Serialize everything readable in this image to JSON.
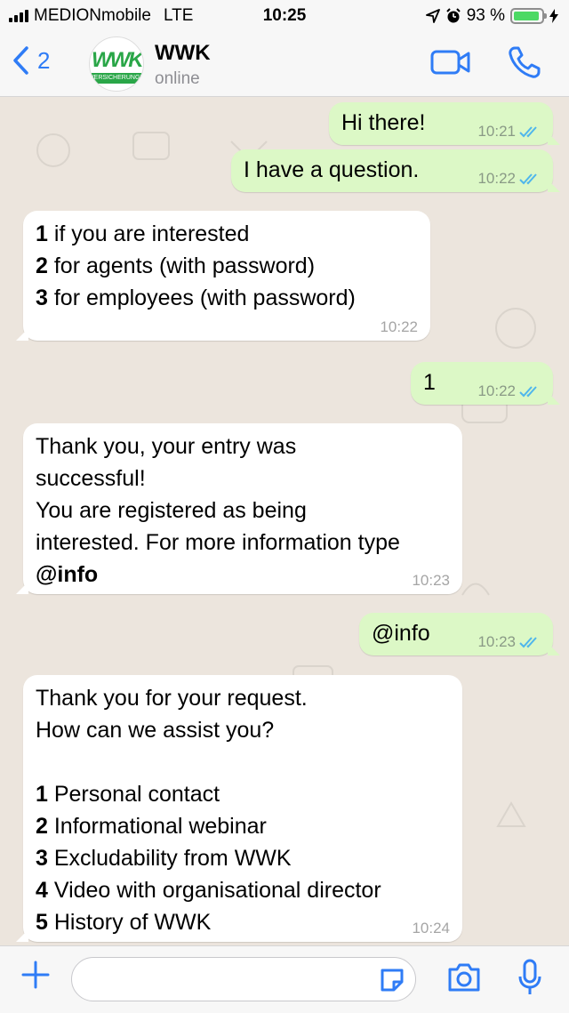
{
  "status_bar": {
    "carrier": "MEDIONmobile",
    "network": "LTE",
    "time": "10:25",
    "battery": "93 %",
    "battery_level": 0.93
  },
  "header": {
    "back_count": "2",
    "contact_name": "WWK",
    "status": "online",
    "avatar_text": "WWK",
    "avatar_band": "VERSICHERUNGEN"
  },
  "messages": [
    {
      "dir": "out",
      "lines": [
        {
          "text": "Hi there!"
        }
      ],
      "time": "10:21",
      "read": true
    },
    {
      "dir": "out",
      "lines": [
        {
          "text": "I have a question."
        }
      ],
      "time": "10:22",
      "read": true
    },
    {
      "dir": "in",
      "lines": [
        {
          "bold": "1",
          "text": " if you are interested"
        },
        {
          "bold": "2",
          "text": " for agents (with password)"
        },
        {
          "bold": "3",
          "text": " for employees (with password)"
        }
      ],
      "time": "10:22"
    },
    {
      "dir": "out",
      "lines": [
        {
          "text": "1"
        }
      ],
      "time": "10:22",
      "read": true
    },
    {
      "dir": "in",
      "lines": [
        {
          "text": "Thank you, your entry was"
        },
        {
          "text": "successful!"
        },
        {
          "text": "You are registered as being"
        },
        {
          "text": "interested. For more information type"
        },
        {
          "bold": "@info",
          "text": ""
        }
      ],
      "time": "10:23"
    },
    {
      "dir": "out",
      "lines": [
        {
          "text": "@info"
        }
      ],
      "time": "10:23",
      "read": true
    },
    {
      "dir": "in",
      "lines": [
        {
          "text": "Thank you for your request."
        },
        {
          "text": "How can we assist you?"
        },
        {
          "text": ""
        },
        {
          "bold": "1",
          "text": " Personal contact"
        },
        {
          "bold": "2",
          "text": " Informational webinar"
        },
        {
          "bold": "3",
          "text": " Excludability from WWK"
        },
        {
          "bold": "4",
          "text": " Video with organisational director"
        },
        {
          "bold": "5",
          "text": " History of WWK"
        }
      ],
      "time": "10:24"
    }
  ],
  "input": {
    "placeholder": ""
  },
  "colors": {
    "accent": "#2f7cf6",
    "outgoing_bubble": "#dcf8c6",
    "incoming_bubble": "#ffffff",
    "read_ticks": "#4fb6ec",
    "chat_background": "#ece5dd"
  },
  "icons": [
    "back-chevron-icon",
    "video-call-icon",
    "phone-icon",
    "plus-icon",
    "sticker-icon",
    "camera-icon",
    "microphone-icon",
    "location-arrow-icon",
    "alarm-icon",
    "charging-bolt-icon"
  ]
}
